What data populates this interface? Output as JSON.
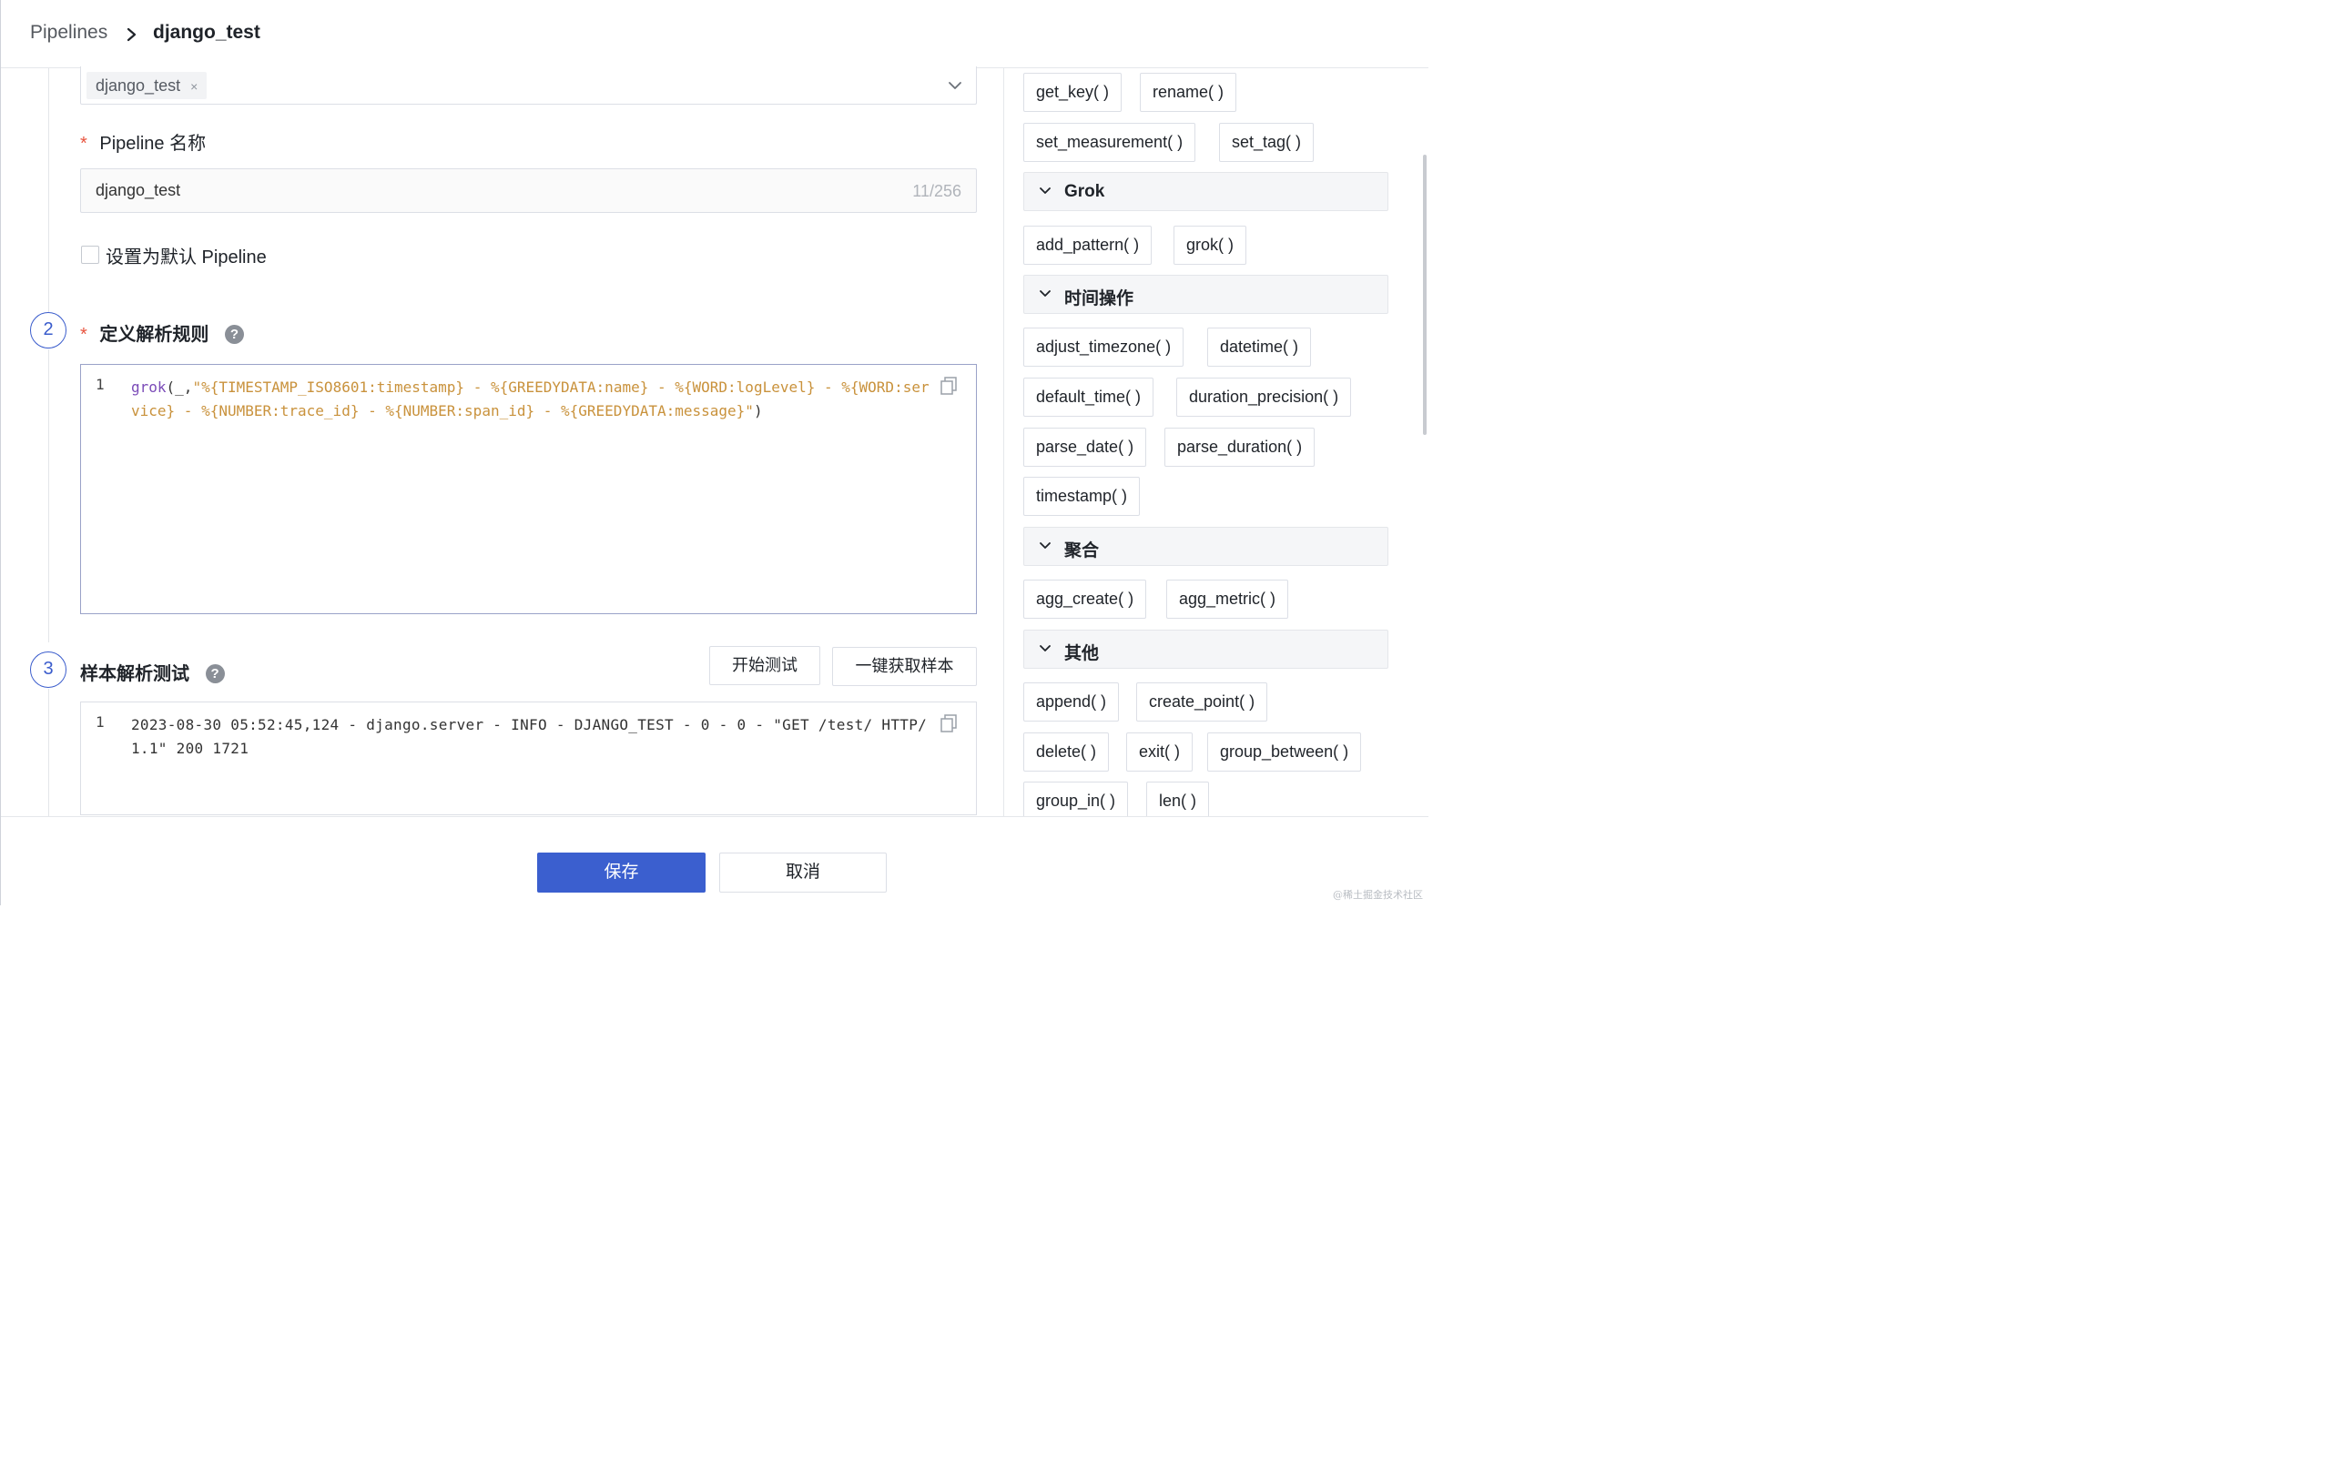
{
  "breadcrumb": {
    "root": "Pipelines",
    "current": "django_test"
  },
  "source_select": {
    "tag": "django_test",
    "tag_close": "×"
  },
  "name_field": {
    "label": "Pipeline 名称",
    "required_mark": "*",
    "value": "django_test",
    "counter": "11/256"
  },
  "default_checkbox": {
    "label": "设置为默认 Pipeline",
    "checked": false
  },
  "step2": {
    "number": "2",
    "required_mark": "*",
    "title": "定义解析规则",
    "help": "?",
    "line_no": "1",
    "code_fn": "grok",
    "code_open": "(_,",
    "code_string": "\"%{TIMESTAMP_ISO8601:timestamp} - %{GREEDYDATA:name} - %{WORD:logLevel} - %{WORD:service} - %{NUMBER:trace_id} - %{NUMBER:span_id} - %{GREEDYDATA:message}\"",
    "code_close": ")"
  },
  "step3": {
    "number": "3",
    "title": "样本解析测试",
    "help": "?",
    "start_test_label": "开始测试",
    "fetch_sample_label": "一键获取样本",
    "line_no": "1",
    "sample": "2023-08-30 05:52:45,124 - django.server - INFO - DJANGO_TEST - 0 - 0 - \"GET /test/ HTTP/1.1\" 200 1721"
  },
  "functions_panel": {
    "top_chips": [
      "get_key( )",
      "rename( )",
      "set_measurement( )",
      "set_tag( )"
    ],
    "groups": [
      {
        "title": "Grok",
        "chips": [
          "add_pattern( )",
          "grok( )"
        ]
      },
      {
        "title": "时间操作",
        "chips": [
          "adjust_timezone( )",
          "datetime( )",
          "default_time( )",
          "duration_precision( )",
          "parse_date( )",
          "parse_duration( )",
          "timestamp( )"
        ]
      },
      {
        "title": "聚合",
        "chips": [
          "agg_create( )",
          "agg_metric( )"
        ]
      },
      {
        "title": "其他",
        "chips": [
          "append( )",
          "create_point( )",
          "delete( )",
          "exit( )",
          "group_between( )",
          "group_in( )",
          "len( )"
        ]
      }
    ]
  },
  "footer": {
    "save_label": "保存",
    "cancel_label": "取消"
  },
  "watermark": "@稀土掘金技术社区",
  "colors": {
    "primary": "#3b5fcf",
    "step_ring": "#3a5ccc",
    "required": "#e8543f",
    "code_function": "#7b4bb8",
    "code_string": "#c9923c"
  }
}
